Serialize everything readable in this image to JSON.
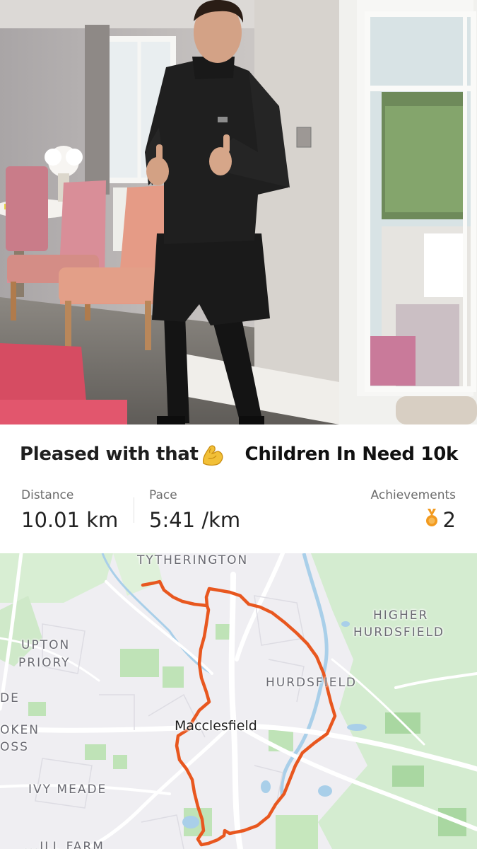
{
  "activity": {
    "title": "Pleased with that",
    "emoji_icon": "flexed-biceps-icon",
    "event_name": "Children In Need 10k"
  },
  "stats": {
    "distance": {
      "label": "Distance",
      "value": "10.01 km"
    },
    "pace": {
      "label": "Pace",
      "value": "5:41 /km"
    },
    "achievements": {
      "label": "Achievements",
      "value": "2",
      "icon": "medal-icon"
    }
  },
  "map": {
    "places": {
      "tytherington": "TYTHERINGTON",
      "higher": "HIGHER",
      "hurdsfield_higher": "HURDSFIELD",
      "upton": "UPTON",
      "priory": "PRIORY",
      "hurdsfield": "HURDSFIELD",
      "de": "DE",
      "oken": "OKEN",
      "oss": "OSS",
      "town": "Macclesfield",
      "ivy_meade": "IVY MEADE",
      "cut_bottom": "...ILL FARM"
    },
    "route_color": "#e8571f"
  },
  "colors": {
    "route": "#e8571f",
    "park_green": "#c7e7bf",
    "water": "#a9cfe9",
    "map_bg": "#efeef2"
  }
}
